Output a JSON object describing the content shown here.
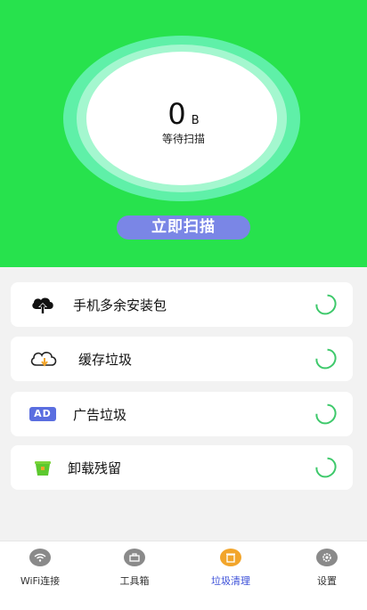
{
  "scan": {
    "value": "0",
    "unit": "B",
    "status": "等待扫描",
    "button_label": "立即扫描"
  },
  "items": [
    {
      "label": "手机多余安装包",
      "icon": "cloud-upload-icon"
    },
    {
      "label": "缓存垃圾",
      "icon": "cloud-download-icon"
    },
    {
      "label": "广告垃圾",
      "icon": "ad-badge-icon",
      "badge": "AD"
    },
    {
      "label": "卸载残留",
      "icon": "trash-basket-icon"
    }
  ],
  "tabs": [
    {
      "label": "WiFi连接",
      "icon": "wifi-icon",
      "active": false
    },
    {
      "label": "工具箱",
      "icon": "toolbox-icon",
      "active": false
    },
    {
      "label": "垃圾清理",
      "icon": "trash-icon",
      "active": true
    },
    {
      "label": "设置",
      "icon": "gear-icon",
      "active": false
    }
  ],
  "colors": {
    "hero_green": "#27e24d",
    "scan_button": "#7a86e6",
    "spinner_green": "#3ec96b",
    "active_tab": "#3b4fd8",
    "active_tab_icon": "#f2a52b"
  }
}
